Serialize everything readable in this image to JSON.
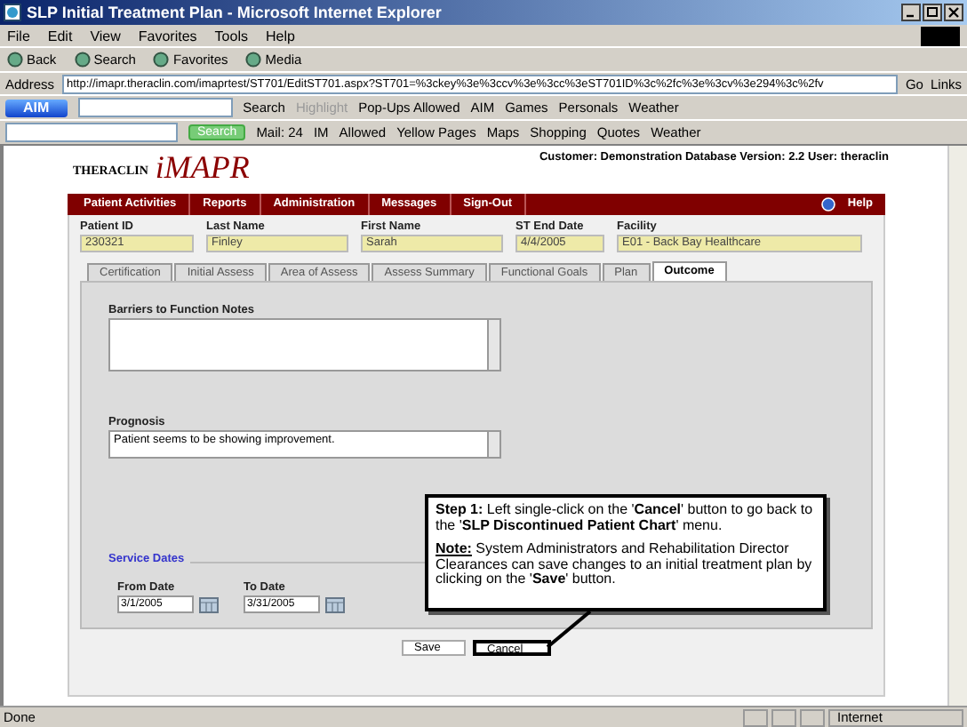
{
  "window": {
    "title": "SLP Initial Treatment Plan - Microsoft Internet Explorer"
  },
  "menu": [
    "File",
    "Edit",
    "View",
    "Favorites",
    "Tools",
    "Help"
  ],
  "toolbar": [
    {
      "label": "Back"
    },
    {
      "label": "Search"
    },
    {
      "label": "Favorites"
    },
    {
      "label": "Media"
    }
  ],
  "address": {
    "label": "Address",
    "url": "http://imapr.theraclin.com/imaprtest/ST701/EditST701.aspx?ST701=%3ckey%3e%3ccv%3e%3cc%3eST701ID%3c%2fc%3e%3cv%3e294%3c%2fv",
    "go": "Go",
    "links": "Links"
  },
  "aim_toolbar": {
    "brand": "AIM",
    "items": [
      {
        "label": "Search",
        "disabled": false
      },
      {
        "label": "Highlight",
        "disabled": true
      },
      {
        "label": "Pop-Ups Allowed",
        "disabled": false
      },
      {
        "label": "AIM",
        "disabled": false
      },
      {
        "label": "Games",
        "disabled": false
      },
      {
        "label": "Personals",
        "disabled": false
      },
      {
        "label": "Weather",
        "disabled": false
      }
    ]
  },
  "search_toolbar": {
    "button": "Search",
    "items": [
      "Mail: 24",
      "IM",
      "Allowed",
      "Yellow Pages",
      "Maps",
      "Shopping",
      "Quotes",
      "Weather"
    ]
  },
  "page": {
    "logo": {
      "company": "THERACLIN",
      "product": "iMAPR"
    },
    "customer_info": "Customer: Demonstration Database Version: 2.2 User: theraclin",
    "nav": [
      "Patient Activities",
      "Reports",
      "Administration",
      "Messages",
      "Sign-Out"
    ],
    "help": "Help",
    "patient_fields": [
      {
        "label": "Patient ID",
        "value": "230321"
      },
      {
        "label": "Last Name",
        "value": "Finley"
      },
      {
        "label": "First Name",
        "value": "Sarah"
      },
      {
        "label": "ST End Date",
        "value": "4/4/2005"
      },
      {
        "label": "Facility",
        "value": "E01 - Back Bay Healthcare"
      }
    ],
    "tabs": [
      {
        "label": "Certification",
        "selected": false
      },
      {
        "label": "Initial Assess",
        "selected": false
      },
      {
        "label": "Area of Assess",
        "selected": false
      },
      {
        "label": "Assess Summary",
        "selected": false
      },
      {
        "label": "Functional Goals",
        "selected": false
      },
      {
        "label": "Plan",
        "selected": false
      },
      {
        "label": "Outcome",
        "selected": true
      }
    ],
    "barriers": {
      "label": "Barriers to Function Notes"
    },
    "prognosis": {
      "label": "Prognosis",
      "value": "Patient seems to be showing improvement."
    },
    "service_dates": {
      "legend": "Service Dates",
      "from": {
        "label": "From Date",
        "value": "3/1/2005"
      },
      "to": {
        "label": "To Date",
        "value": "3/31/2005"
      }
    },
    "buttons": [
      {
        "label": "Save",
        "highlighted": false
      },
      {
        "label": "Cancel",
        "highlighted": true
      }
    ],
    "callout": {
      "step": "**Step 1:** Left single-click on the '**Cancel**' button to go back to the '**SLP Discontinued Patient Chart**' menu.",
      "note": "**Note:** System Administrators and Rehabilitation Director Clearances can save changes to an initial treatment plan by clicking on the '**Save**' button."
    }
  },
  "status_bar": {
    "status": "Done",
    "zone": "Internet"
  }
}
